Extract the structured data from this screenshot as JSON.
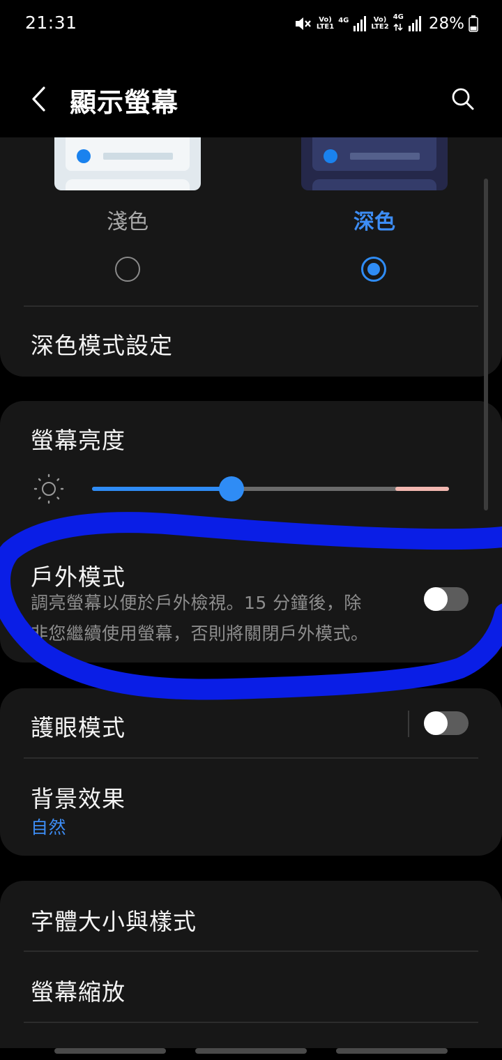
{
  "status_bar": {
    "time": "21:31",
    "sim1_volte": "Vo)",
    "sim1_tag": "LTE1",
    "sim1_network": "4G",
    "sim2_volte": "Vo)",
    "sim2_tag": "LTE2",
    "sim2_network": "4G",
    "battery": "28%"
  },
  "header": {
    "title": "顯示螢幕"
  },
  "theme": {
    "light_label": "淺色",
    "dark_label": "深色",
    "selected": "dark",
    "settings_label": "深色模式設定"
  },
  "brightness": {
    "title": "螢幕亮度",
    "level": 0.39,
    "extra_start": 0.85
  },
  "outdoor": {
    "title": "戶外模式",
    "description_line1": "調亮螢幕以便於戶外檢視。15 分鐘後，除",
    "description_line2": "非您繼續使用螢幕，否則將關閉戶外模式。",
    "enabled": false
  },
  "eye_comfort": {
    "title": "護眼模式",
    "enabled": false
  },
  "background_effect": {
    "title": "背景效果",
    "value": "自然"
  },
  "font": {
    "title": "字體大小與樣式"
  },
  "zoom": {
    "title": "螢幕縮放"
  },
  "colors": {
    "accent": "#2f8cf5",
    "card": "#171717",
    "annotation": "#0a1ee6"
  }
}
